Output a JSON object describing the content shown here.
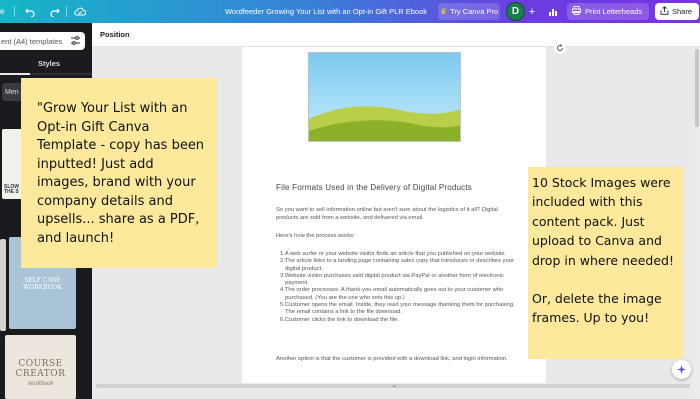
{
  "topbar": {
    "file_partial": "e",
    "title": "Wordfeeder Growing Your List with an Opt-in Gift PLR Ebook",
    "try_pro": "Try Canva Pro",
    "avatar_letter": "D",
    "print_label": "Print Letterheads",
    "share_label": "Share"
  },
  "sidebar": {
    "search_placeholder": "ent (A4) templates",
    "styles_tab": "Styles",
    "menu_chip": "Men",
    "thumb1_text": "SLOW\nTHE S",
    "thumb2_text": "SELF CARE\nWORKBOOK",
    "thumb3_title": "COURSE\nCREATOR",
    "thumb3_sub": "workbook"
  },
  "toolbar": {
    "position_label": "Position"
  },
  "page": {
    "heading": "File Formats Used in the Delivery of Digital Products",
    "intro": "So you want to sell information online but aren't sure about the logistics of it all? Digital products are sold from a website, and delivered via email.",
    "process_intro": "Here's how the process works:",
    "steps": [
      "1.A web surfer or your website visitor finds an article that you published on your website.",
      "2.The article links to a landing page containing sales copy that introduces or describes your digital product.",
      "3.Website visitor purchases said digital product via PayPal or another form of electronic payment.",
      "4.The order processes. A thank-you email automatically goes out to your customer who purchased. (You are the one who sets this up.)",
      "5.Customer opens the email. Inside, they read your message thanking them for purchasing. The email contains a link to the file download.",
      "6.Customer clicks the link to download the file."
    ],
    "closing": "Another option is that the customer is provided with a download link, and login information."
  },
  "notes": {
    "left": "\"Grow Your List with an Opt-in Gift Canva Template - copy has been inputted! Just add images, brand with your company details and upsells... share as a PDF, and launch!",
    "right_p1": "10 Stock Images were included with this content pack. Just upload to Canva and drop in where needed!",
    "right_p2": "Or, delete the image frames. Up to you!"
  },
  "colors": {
    "accent": "#7a33e0",
    "note_bg": "#fde99c",
    "avatar": "#1c7d4c"
  }
}
